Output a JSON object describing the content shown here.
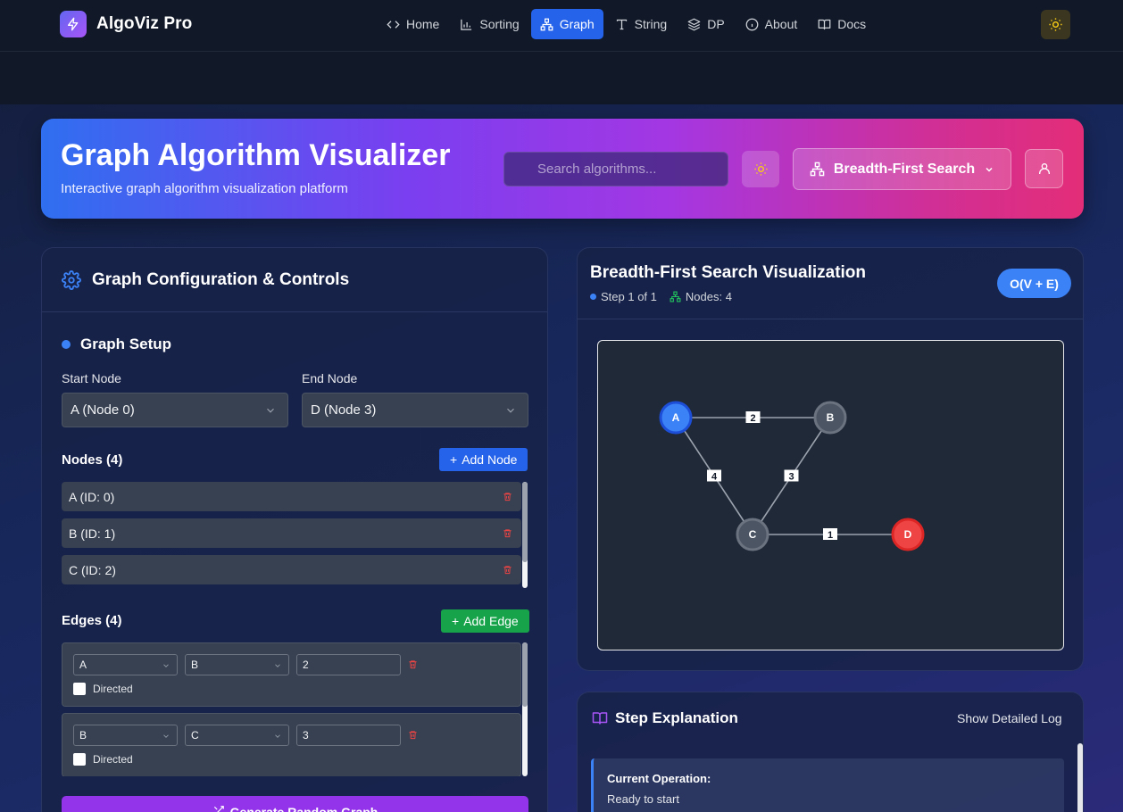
{
  "brand": {
    "name": "AlgoViz Pro"
  },
  "nav": {
    "links": [
      {
        "label": "Home",
        "icon": "code-icon"
      },
      {
        "label": "Sorting",
        "icon": "bar-chart-icon"
      },
      {
        "label": "Graph",
        "icon": "network-icon",
        "active": true
      },
      {
        "label": "String",
        "icon": "text-icon"
      },
      {
        "label": "DP",
        "icon": "layers-icon"
      },
      {
        "label": "About",
        "icon": "info-icon"
      },
      {
        "label": "Docs",
        "icon": "book-icon"
      }
    ],
    "theme_icon": "sun-icon"
  },
  "hero": {
    "title": "Graph Algorithm Visualizer",
    "subtitle": "Interactive graph algorithm visualization platform",
    "search_placeholder": "Search algorithms...",
    "algorithm_selected": "Breadth-First Search"
  },
  "config": {
    "title": "Graph Configuration & Controls",
    "setup_title": "Graph Setup",
    "start_label": "Start Node",
    "start_value": "A (Node 0)",
    "end_label": "End Node",
    "end_value": "D (Node 3)",
    "nodes_heading": "Nodes (4)",
    "add_node_label": "Add Node",
    "nodes": [
      {
        "label": "A (ID: 0)"
      },
      {
        "label": "B (ID: 1)"
      },
      {
        "label": "C (ID: 2)"
      }
    ],
    "edges_heading": "Edges (4)",
    "add_edge_label": "Add Edge",
    "edges": [
      {
        "from": "A",
        "to": "B",
        "weight": "2",
        "directed_label": "Directed"
      },
      {
        "from": "B",
        "to": "C",
        "weight": "3",
        "directed_label": "Directed"
      }
    ],
    "generate_label": "Generate Random Graph"
  },
  "viz": {
    "title": "Breadth-First Search Visualization",
    "step": "Step 1 of 1",
    "nodes": "Nodes: 4",
    "complexity": "O(V + E)",
    "graph": {
      "nodes": [
        {
          "id": "A",
          "state": "start",
          "color": "#3b82f6"
        },
        {
          "id": "B",
          "state": "default",
          "color": "#4b5563"
        },
        {
          "id": "C",
          "state": "default",
          "color": "#4b5563"
        },
        {
          "id": "D",
          "state": "end",
          "color": "#ef4444"
        }
      ],
      "edges": [
        {
          "from": "A",
          "to": "B",
          "weight": "2"
        },
        {
          "from": "B",
          "to": "C",
          "weight": "3"
        },
        {
          "from": "A",
          "to": "C",
          "weight": "4"
        },
        {
          "from": "C",
          "to": "D",
          "weight": "1"
        }
      ]
    }
  },
  "steps": {
    "title": "Step Explanation",
    "log_link": "Show Detailed Log",
    "current_label": "Current Operation:",
    "current_value": "Ready to start"
  },
  "colors": {
    "accent": "#2563eb",
    "green": "#16a34a",
    "purple": "#9333ea",
    "danger": "#ef4444"
  }
}
